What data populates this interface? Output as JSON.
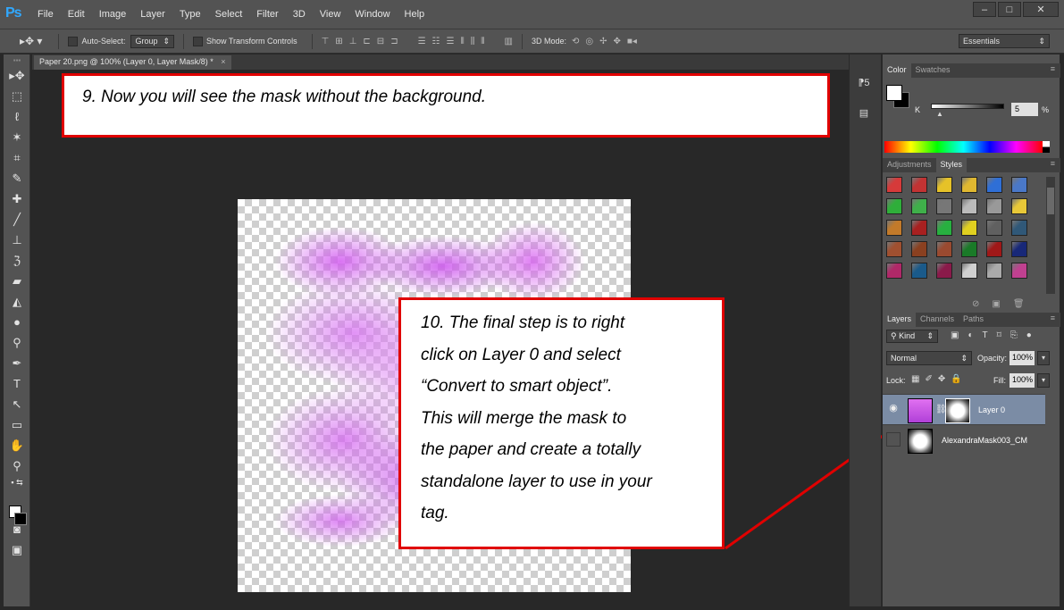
{
  "app": {
    "logo": "Ps"
  },
  "menu": [
    "File",
    "Edit",
    "Image",
    "Layer",
    "Type",
    "Select",
    "Filter",
    "3D",
    "View",
    "Window",
    "Help"
  ],
  "window_controls": [
    "–",
    "□",
    "✕"
  ],
  "options": {
    "auto_select_label": "Auto-Select:",
    "auto_select_value": "Group",
    "show_transform_label": "Show Transform Controls",
    "mode_3d_label": "3D Mode:",
    "workspace": "Essentials"
  },
  "document": {
    "tab_title": "Paper 20.png @ 100% (Layer 0, Layer Mask/8) *",
    "close": "×"
  },
  "callouts": {
    "step9": "9.  Now you will see the mask without the background.",
    "step10": "10.  The final step is to right\nclick on Layer 0 and select\n“Convert to smart object”.\nThis  will merge the mask to\nthe  paper and create a totally\nstandalone layer to use in your\ntag."
  },
  "color_panel": {
    "tabs": [
      "Color",
      "Swatches"
    ],
    "k_label": "K",
    "k_value": "5",
    "pct": "%"
  },
  "styles_panel": {
    "tabs": [
      "Adjustments",
      "Styles"
    ],
    "swatches": [
      "#d63a3a",
      "#c23333",
      "#e6c228",
      "#e0b830",
      "#2f6fd6",
      "#4a78c8",
      "#2fae3a",
      "#3fb04a",
      "#777777",
      "#bbbbbb",
      "#999999",
      "#e8c838",
      "#c27a2a",
      "#a82020",
      "#28b040",
      "#e0d020",
      "#606060",
      "#305878",
      "#a05030",
      "#8a4020",
      "#9a4a30",
      "#1a7a28",
      "#a01818",
      "#182878",
      "#b02868",
      "#1a5a8a",
      "#8a1a4a",
      "#d0d0d0",
      "#aaaaaa",
      "#c04090"
    ]
  },
  "layers_panel": {
    "tabs": [
      "Layers",
      "Channels",
      "Paths"
    ],
    "filter": "Kind",
    "blend_mode": "Normal",
    "opacity_label": "Opacity:",
    "opacity_value": "100%",
    "lock_label": "Lock:",
    "fill_label": "Fill:",
    "fill_value": "100%",
    "layers": [
      {
        "name": "Layer 0"
      },
      {
        "name": "AlexandraMask003_CM"
      }
    ]
  }
}
